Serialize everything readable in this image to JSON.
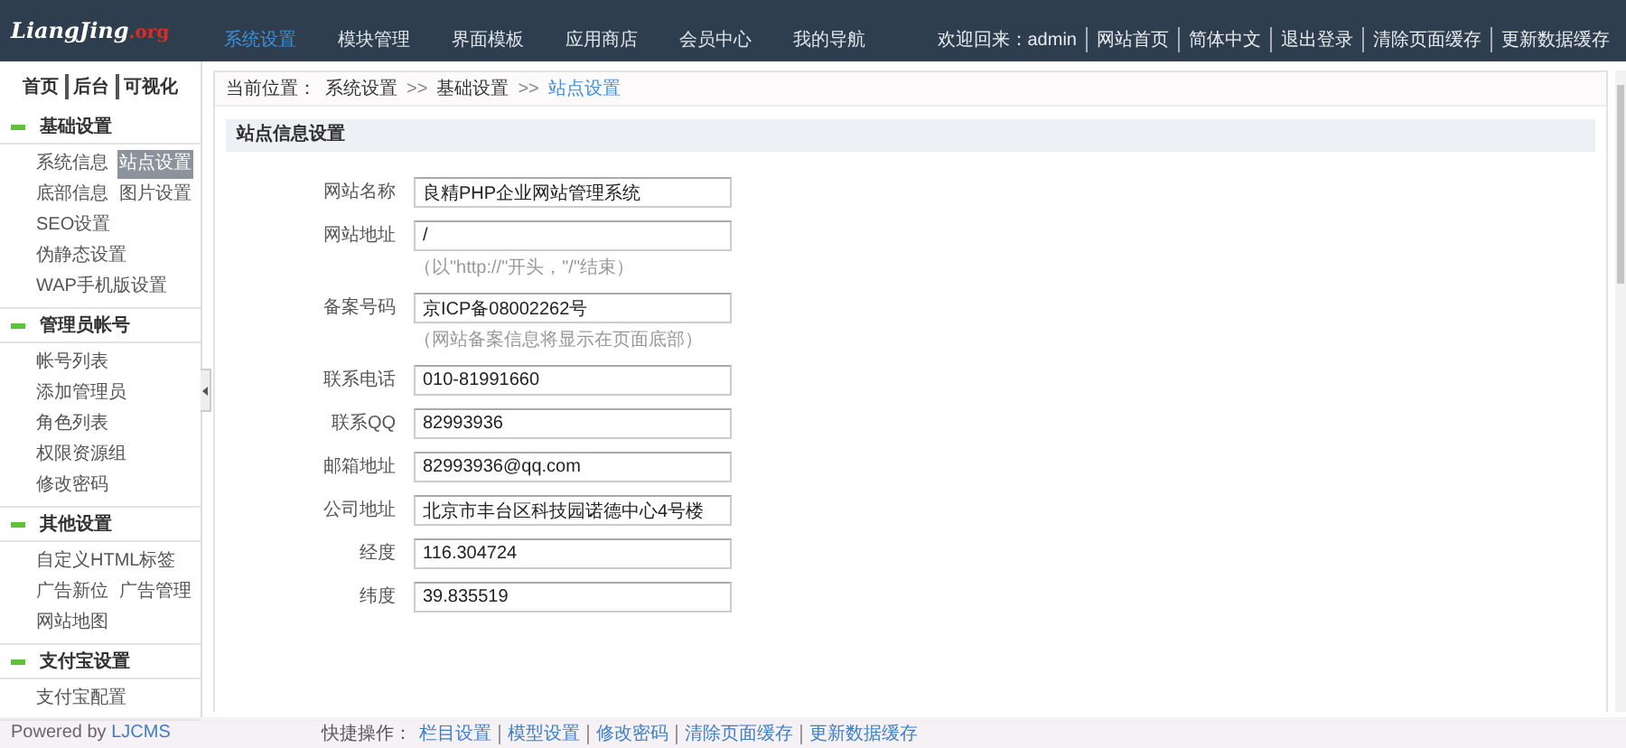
{
  "header": {
    "logo": {
      "main": "LiangJing",
      "suffix": ".org"
    },
    "nav": [
      {
        "label": "系统设置",
        "selected": true
      },
      {
        "label": "模块管理",
        "selected": false
      },
      {
        "label": "界面模板",
        "selected": false
      },
      {
        "label": "应用商店",
        "selected": false
      },
      {
        "label": "会员中心",
        "selected": false
      },
      {
        "label": "我的导航",
        "selected": false
      }
    ],
    "links": [
      "欢迎回来：admin",
      "网站首页",
      "简体中文",
      "退出登录",
      "清除页面缓存",
      "更新数据缓存"
    ]
  },
  "sidebar": {
    "top_links": [
      "首页",
      "后台",
      "可视化"
    ],
    "groups": [
      {
        "title": "基础设置",
        "items": [
          {
            "label": "系统信息",
            "selected": false
          },
          {
            "label": "站点设置",
            "selected": true
          },
          {
            "label": "底部信息",
            "selected": false
          },
          {
            "label": "图片设置",
            "selected": false
          },
          {
            "label": "SEO设置",
            "selected": false
          },
          {
            "label": "伪静态设置",
            "selected": false
          },
          {
            "label": "WAP手机版设置",
            "selected": false
          }
        ]
      },
      {
        "title": "管理员帐号",
        "items": [
          {
            "label": "帐号列表",
            "selected": false
          },
          {
            "label": "添加管理员",
            "selected": false
          },
          {
            "label": "角色列表",
            "selected": false
          },
          {
            "label": "权限资源组",
            "selected": false
          },
          {
            "label": "修改密码",
            "selected": false
          }
        ]
      },
      {
        "title": "其他设置",
        "items": [
          {
            "label": "自定义HTML标签",
            "selected": false
          },
          {
            "label": "广告新位",
            "selected": false
          },
          {
            "label": "广告管理",
            "selected": false
          },
          {
            "label": "网站地图",
            "selected": false
          }
        ]
      },
      {
        "title": "支付宝设置",
        "items": [
          {
            "label": "支付宝配置",
            "selected": false
          }
        ]
      }
    ]
  },
  "breadcrumb": {
    "label": "当前位置：",
    "items": [
      {
        "kind": "link",
        "text": "系统设置"
      },
      {
        "kind": "sep",
        "text": ">>"
      },
      {
        "kind": "link",
        "text": "基础设置"
      },
      {
        "kind": "sep",
        "text": ">>"
      },
      {
        "kind": "current",
        "text": "站点设置"
      }
    ]
  },
  "section_title": "站点信息设置",
  "form": [
    {
      "label": "网站名称",
      "value": "良精PHP企业网站管理系统"
    },
    {
      "label": "网站地址",
      "value": "/",
      "hint": "（以\"http://\"开头，\"/\"结束）"
    },
    {
      "label": "备案号码",
      "value": "京ICP备08002262号",
      "hint": "（网站备案信息将显示在页面底部）"
    },
    {
      "label": "联系电话",
      "value": "010-81991660"
    },
    {
      "label": "联系QQ",
      "value": "82993936"
    },
    {
      "label": "邮箱地址",
      "value": "82993936@qq.com"
    },
    {
      "label": "公司地址",
      "value": "北京市丰台区科技园诺德中心4号楼"
    },
    {
      "label": "经度",
      "value": "116.304724"
    },
    {
      "label": "纬度",
      "value": "39.835519"
    }
  ],
  "footer": {
    "powered": {
      "text": "Powered by ",
      "brand": "LJCMS"
    },
    "quick_label": "快捷操作：",
    "quick_links": [
      "栏目设置",
      "模型设置",
      "修改密码",
      "清除页面缓存",
      "更新数据缓存"
    ]
  }
}
